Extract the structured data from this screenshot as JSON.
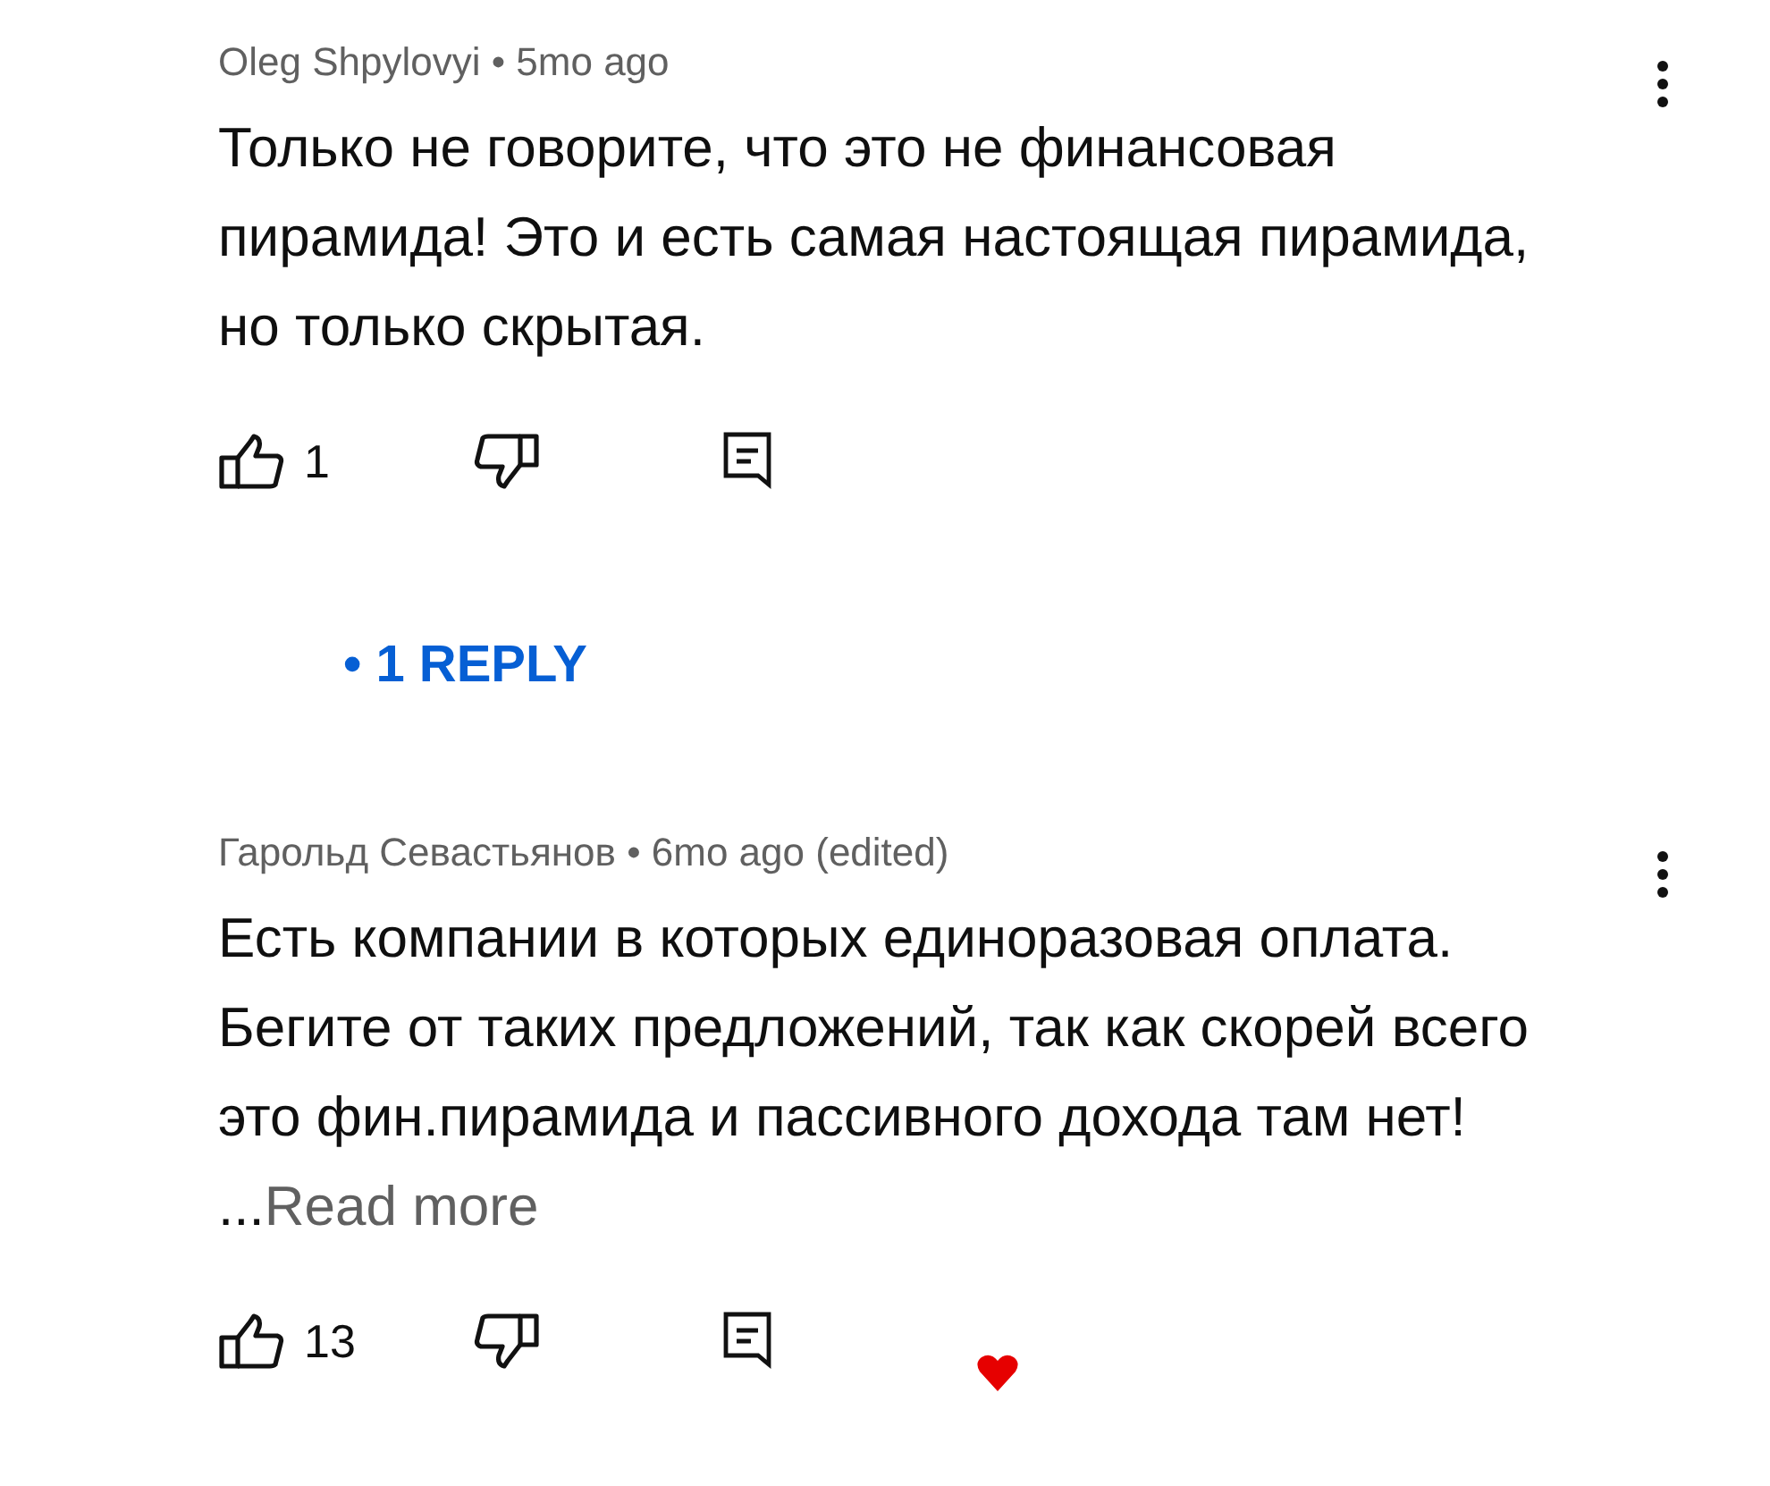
{
  "comments": [
    {
      "meta": "Oleg Shpylovyi • 5mo ago",
      "text": "Только не говорите, что это не финансовая пирамида! Это и есть самая настоящая пирамида, но только скрытая.",
      "likes": "1",
      "hearted": false,
      "replies": "• 1 REPLY"
    },
    {
      "meta": "Гарольд Севастьянов • 6mo ago (edited)",
      "text": "Есть компании в которых единоразовая оплата. Бегите от таких предложений, так как скорей всего это фин.пирамида и пассивного дохода там нет! ...",
      "read_more": "Read more",
      "likes": "13",
      "hearted": true
    }
  ]
}
